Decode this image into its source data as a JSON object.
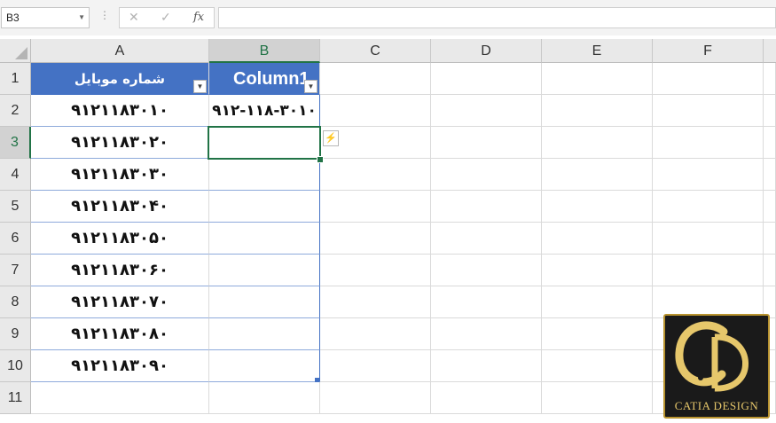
{
  "formula_bar": {
    "name_box": "B3",
    "cancel_icon": "✕",
    "enter_icon": "✓",
    "function_icon": "fx",
    "formula_value": ""
  },
  "columns": [
    "A",
    "B",
    "C",
    "D",
    "E",
    "F"
  ],
  "rows": [
    "1",
    "2",
    "3",
    "4",
    "5",
    "6",
    "7",
    "8",
    "9",
    "10",
    "11"
  ],
  "table": {
    "header_a": "شماره موبایل",
    "header_b": "Column1",
    "a_values": [
      "۹۱۲۱۱۸۳۰۱۰",
      "۹۱۲۱۱۸۳۰۲۰",
      "۹۱۲۱۱۸۳۰۳۰",
      "۹۱۲۱۱۸۳۰۴۰",
      "۹۱۲۱۱۸۳۰۵۰",
      "۹۱۲۱۱۸۳۰۶۰",
      "۹۱۲۱۱۸۳۰۷۰",
      "۹۱۲۱۱۸۳۰۸۰",
      "۹۱۲۱۱۸۳۰۹۰"
    ],
    "b2_value": "۹۱۲-۱۱۸-۳۰۱۰"
  },
  "active_cell": "B3",
  "logo": {
    "monogram": "CD",
    "text": "CATIA DESIGN"
  },
  "colors": {
    "table_header": "#4472c4",
    "selection": "#217346",
    "logo_gold": "#e6c76b"
  },
  "icons": {
    "filter": "filter-dropdown-icon",
    "flash_fill": "flash-fill-icon"
  }
}
